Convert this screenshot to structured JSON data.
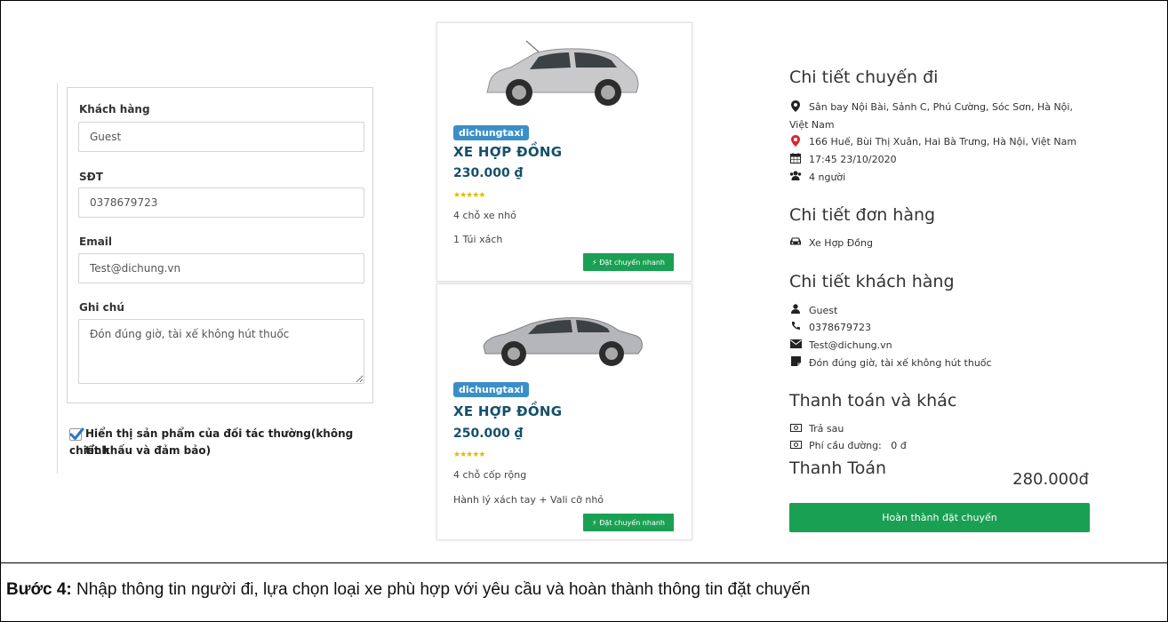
{
  "form": {
    "customer_label": "Khách hàng",
    "customer_value": "Guest",
    "phone_label": "SĐT",
    "phone_value": "0378679723",
    "email_label": "Email",
    "email_value": "Test@dichung.vn",
    "note_label": "Ghi chú",
    "note_value": "Đón đúng giờ, tài xế không hút thuốc",
    "partner_checkbox_label_1": "Hiển thị sản phẩm của đối tác thường(không tính",
    "partner_checkbox_label_2": "chiết khấu và đảm bảo)",
    "partner_checked": true
  },
  "cards": [
    {
      "badge": "dichungtaxi",
      "title": "XE HỢP ĐỒNG",
      "price": "230.000 ₫",
      "rating": 5,
      "seats": "4 chỗ xe nhỏ",
      "luggage": "1 Túi xách",
      "quick_label": "Đặt chuyến nhanh"
    },
    {
      "badge": "dichungtaxi",
      "title": "XE HỢP ĐỒNG",
      "price": "250.000 ₫",
      "rating": 5,
      "seats": "4 chỗ cốp rộng",
      "luggage": "Hành lý xách tay + Vali cỡ nhỏ",
      "quick_label": "Đặt chuyến nhanh"
    }
  ],
  "trip": {
    "title": "Chi tiết chuyến đi",
    "pickup_1": "Sân bay Nội Bài, Sảnh C, Phú Cường, Sóc Sơn, Hà Nội,",
    "pickup_2": "Việt Nam",
    "dropoff": "166 Huế, Bùi Thị Xuân, Hai Bà Trưng, Hà Nội, Việt Nam",
    "datetime": "17:45 23/10/2020",
    "passengers": "4 người"
  },
  "order": {
    "title": "Chi tiết đơn hàng",
    "vehicle": "Xe Hợp Đồng"
  },
  "customer": {
    "title": "Chi tiết khách hàng",
    "name": "Guest",
    "phone": "0378679723",
    "email": "Test@dichung.vn",
    "note": "Đón đúng giờ, tài xế không hút thuốc"
  },
  "payment": {
    "title": "Thanh toán và khác",
    "method": "Trả sau",
    "toll": "Phí cầu đường:   0 đ",
    "total_label": "Thanh Toán",
    "total_value": "280.000đ",
    "finish_label": "Hoàn thành đặt chuyến"
  },
  "caption": {
    "bold": "Bước 4:",
    "text": " Nhập thông tin người đi, lựa chọn loại xe phù hợp với yêu cầu và hoàn thành thông tin đặt chuyến"
  },
  "colors": {
    "accent_green": "#1aa053",
    "badge_blue": "#3a8fc7",
    "title_navy": "#15506b",
    "star_gold": "#e6b800",
    "pin_red": "#d9262c"
  },
  "icons": {
    "pickup": "map-marker-icon",
    "dropoff": "map-marker-red-icon",
    "datetime": "calendar-icon",
    "passengers": "users-icon",
    "vehicle": "car-icon",
    "name": "user-icon",
    "phone": "phone-icon",
    "email": "envelope-icon",
    "note": "sticky-note-icon",
    "method": "money-icon",
    "toll": "money-icon",
    "quick": "bolt-icon",
    "check": "checkmark-icon"
  }
}
